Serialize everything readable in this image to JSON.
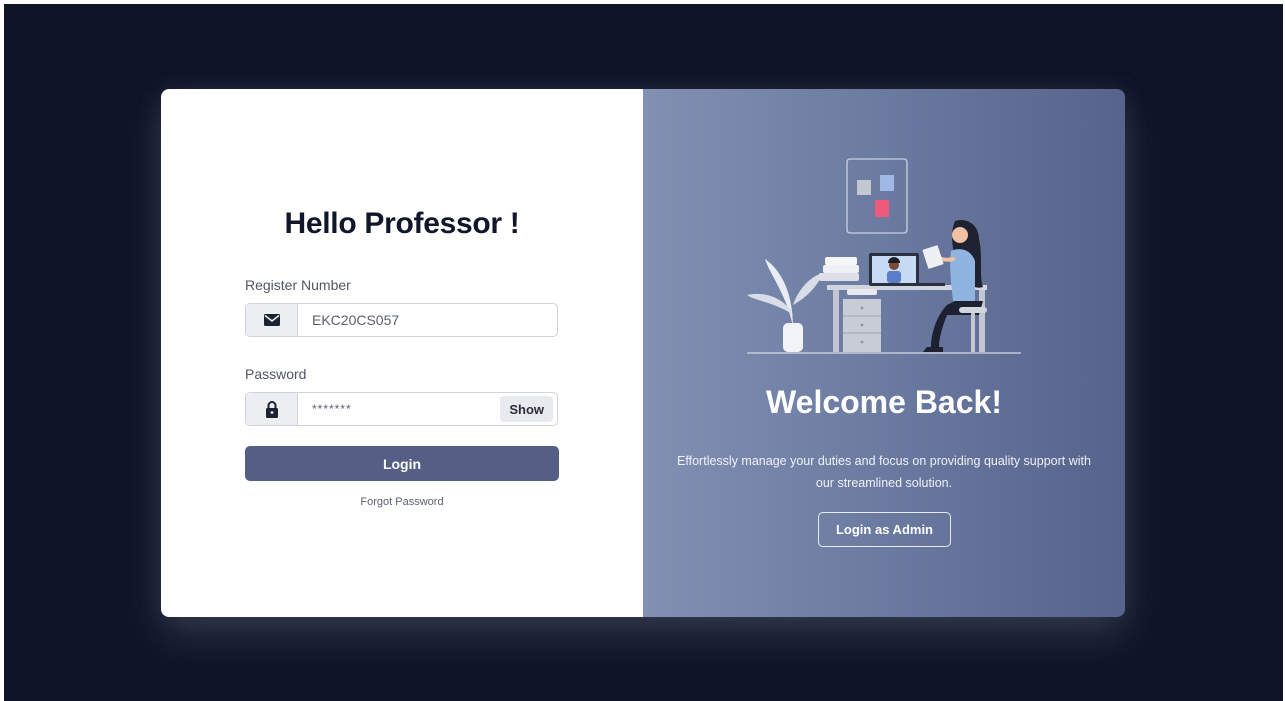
{
  "login": {
    "title": "Hello Professor !",
    "register_label": "Register Number",
    "register_value": "EKC20CS057",
    "password_label": "Password",
    "password_value": "*******",
    "show_label": "Show",
    "login_label": "Login",
    "forgot_label": "Forgot Password"
  },
  "welcome": {
    "title": "Welcome Back!",
    "description": "Effortlessly manage your duties and focus on providing quality support with our streamlined solution.",
    "admin_label": "Login as Admin"
  },
  "icons": {
    "register": "envelope-icon",
    "password": "lock-icon"
  },
  "colors": {
    "background": "#0f1426",
    "primary_button": "#555f85",
    "panel_gradient_start": "#8190b3",
    "panel_gradient_end": "#56638c",
    "title_text": "#11172b"
  }
}
